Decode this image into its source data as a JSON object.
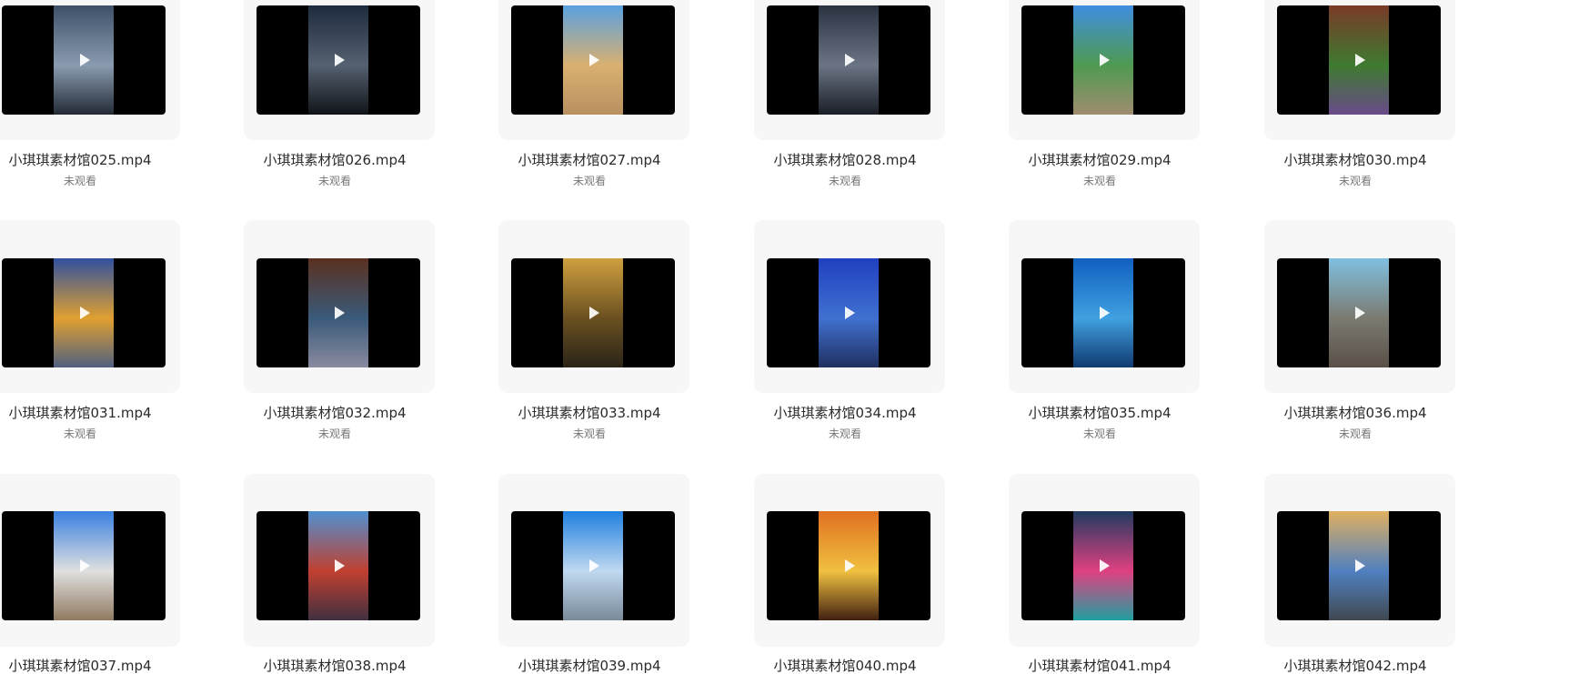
{
  "files": [
    {
      "name": "小琪琪素材馆025.mp4",
      "status": "未观看",
      "thumb_colors": [
        "#3e5068",
        "#8a9bb0",
        "#232a35"
      ]
    },
    {
      "name": "小琪琪素材馆026.mp4",
      "status": "未观看",
      "thumb_colors": [
        "#1e2a3e",
        "#556070",
        "#101418"
      ]
    },
    {
      "name": "小琪琪素材馆027.mp4",
      "status": "未观看",
      "thumb_colors": [
        "#5aa0e0",
        "#d9b070",
        "#b89060"
      ]
    },
    {
      "name": "小琪琪素材馆028.mp4",
      "status": "未观看",
      "thumb_colors": [
        "#2a3240",
        "#6a7484",
        "#1a1e26"
      ]
    },
    {
      "name": "小琪琪素材馆029.mp4",
      "status": "未观看",
      "thumb_colors": [
        "#3f8ee0",
        "#4f9a50",
        "#a08c70"
      ]
    },
    {
      "name": "小琪琪素材馆030.mp4",
      "status": "未观看",
      "thumb_colors": [
        "#7a3a28",
        "#3e7a30",
        "#6a4a8a"
      ]
    },
    {
      "name": "小琪琪素材馆031.mp4",
      "status": "未观看",
      "thumb_colors": [
        "#3050a0",
        "#e0a030",
        "#506080"
      ]
    },
    {
      "name": "小琪琪素材馆032.mp4",
      "status": "未观看",
      "thumb_colors": [
        "#5a3020",
        "#3a5a7a",
        "#8a8aa0"
      ]
    },
    {
      "name": "小琪琪素材馆033.mp4",
      "status": "未观看",
      "thumb_colors": [
        "#d0a040",
        "#6a5020",
        "#2a2418"
      ]
    },
    {
      "name": "小琪琪素材馆034.mp4",
      "status": "未观看",
      "thumb_colors": [
        "#2040c0",
        "#4070d0",
        "#203060"
      ]
    },
    {
      "name": "小琪琪素材馆035.mp4",
      "status": "未观看",
      "thumb_colors": [
        "#1060c0",
        "#40a0e0",
        "#103a70"
      ]
    },
    {
      "name": "小琪琪素材馆036.mp4",
      "status": "未观看",
      "thumb_colors": [
        "#80c0e0",
        "#7a7a70",
        "#5a5048"
      ]
    },
    {
      "name": "小琪琪素材馆037.mp4",
      "status": "未观看",
      "thumb_colors": [
        "#3a80e0",
        "#e0e0e0",
        "#907a60"
      ]
    },
    {
      "name": "小琪琪素材馆038.mp4",
      "status": "未观看",
      "thumb_colors": [
        "#5090d0",
        "#c04030",
        "#403040"
      ]
    },
    {
      "name": "小琪琪素材馆039.mp4",
      "status": "未观看",
      "thumb_colors": [
        "#2080e0",
        "#c0d8f0",
        "#7a8a9a"
      ]
    },
    {
      "name": "小琪琪素材馆040.mp4",
      "status": "未观看",
      "thumb_colors": [
        "#e07020",
        "#f0c040",
        "#402010"
      ]
    },
    {
      "name": "小琪琪素材馆041.mp4",
      "status": "未观看",
      "thumb_colors": [
        "#203a60",
        "#e04080",
        "#20a0a0"
      ]
    },
    {
      "name": "小琪琪素材馆042.mp4",
      "status": "未观看",
      "thumb_colors": [
        "#e0b060",
        "#5080c0",
        "#404850"
      ]
    }
  ]
}
